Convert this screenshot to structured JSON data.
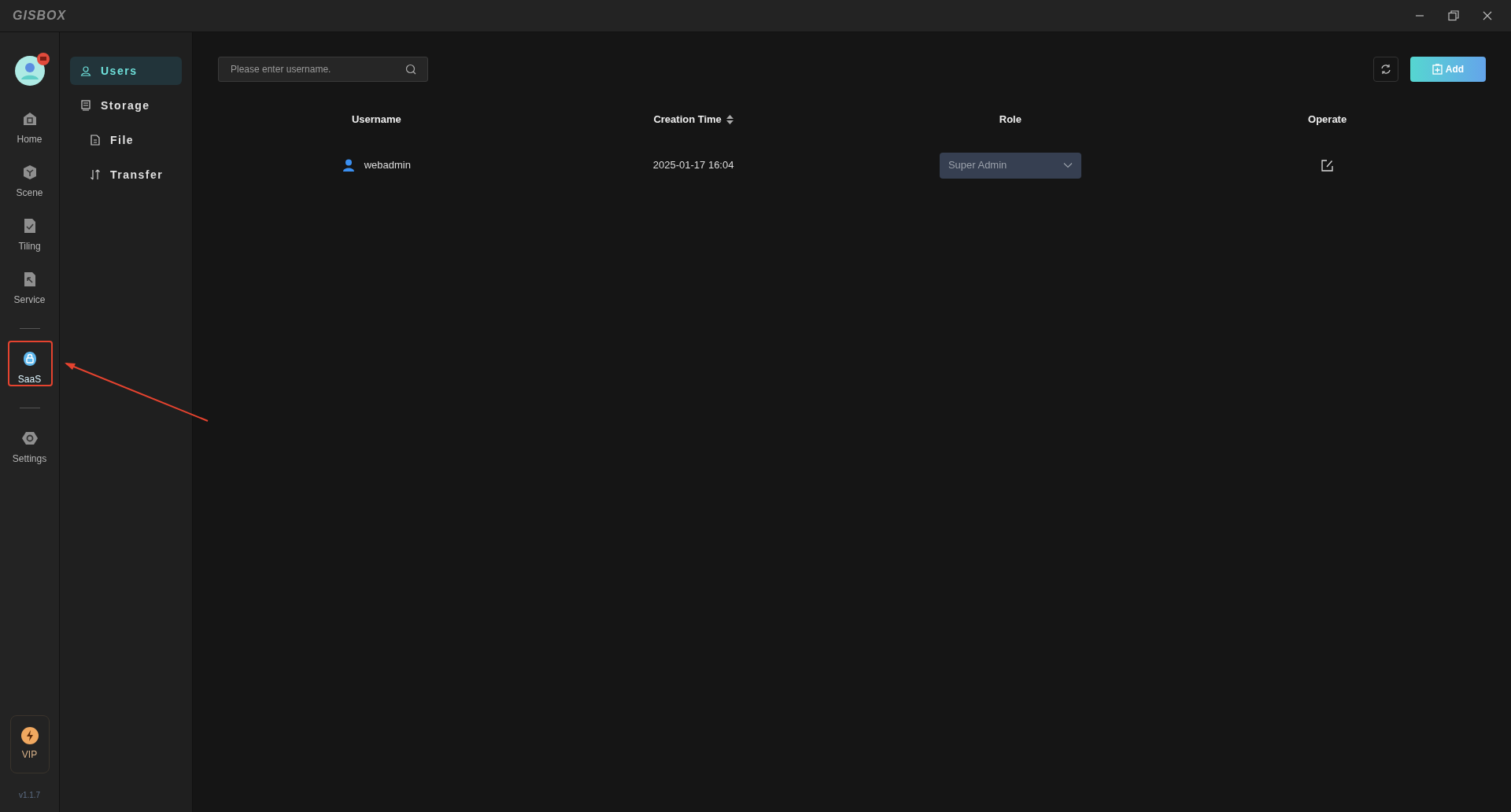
{
  "window": {
    "logo": "GISBOX"
  },
  "rail": {
    "items": [
      {
        "kind": "home",
        "label": "Home",
        "selected": false
      },
      {
        "kind": "scene",
        "label": "Scene",
        "selected": false
      },
      {
        "kind": "tiling",
        "label": "Tiling",
        "selected": false
      },
      {
        "kind": "service",
        "label": "Service",
        "selected": false
      },
      {
        "kind": "divider"
      },
      {
        "kind": "saas",
        "label": "SaaS",
        "selected": true
      },
      {
        "kind": "divider"
      },
      {
        "kind": "settings",
        "label": "Settings",
        "selected": false
      }
    ],
    "vip": "VIP",
    "version": "v1.1.7"
  },
  "subnav": [
    {
      "kind": "user",
      "label": "Users",
      "selected": true
    },
    {
      "kind": "storage",
      "label": "Storage",
      "selected": false,
      "children": [
        {
          "kind": "file",
          "label": "File",
          "selected": false
        },
        {
          "kind": "transfer",
          "label": "Transfer",
          "selected": false
        }
      ]
    }
  ],
  "search": {
    "placeholder": "Please enter username."
  },
  "add_button": "Add",
  "table": {
    "columns": [
      "Username",
      "Creation Time",
      "Role",
      "Operate"
    ],
    "rows": [
      {
        "username": "webadmin",
        "created": "2025-01-17 16:04",
        "role": "Super Admin"
      }
    ]
  }
}
